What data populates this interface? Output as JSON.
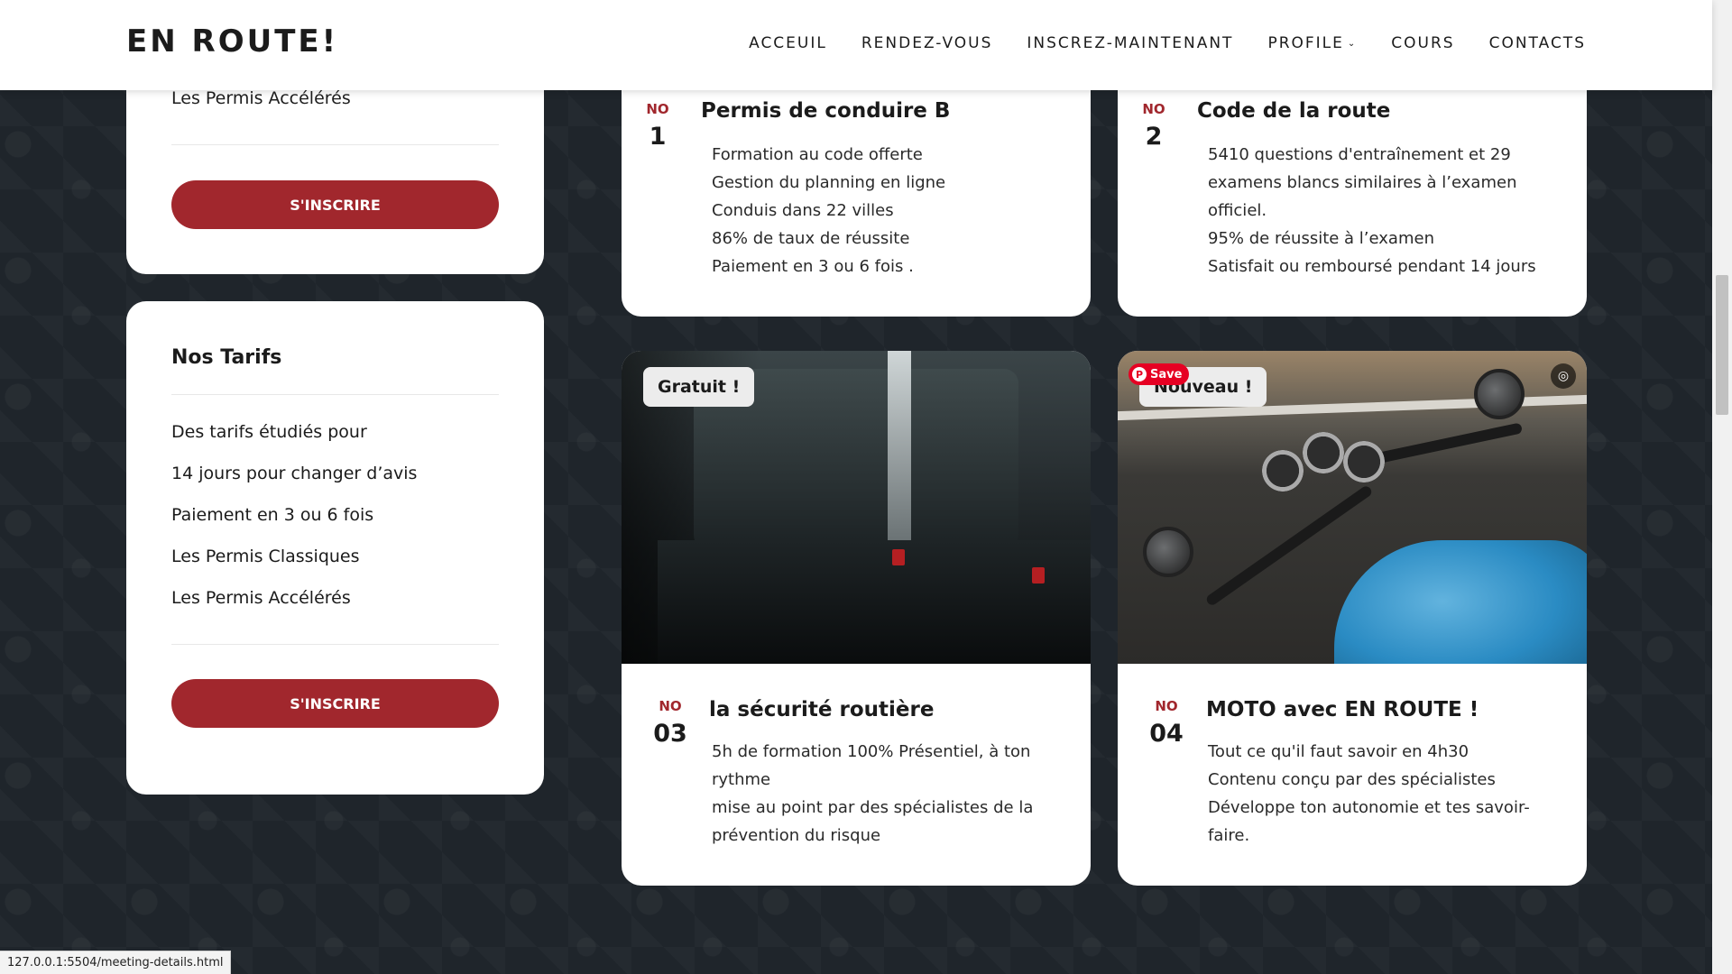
{
  "header": {
    "logo": "EN ROUTE!",
    "nav": [
      "ACCEUIL",
      "RENDEZ-VOUS",
      "INSCREZ-MAINTENANT",
      "PROFILE",
      "COURS",
      "CONTACTS"
    ]
  },
  "sidebar": {
    "top_card": {
      "item": "Les Permis Accélérés",
      "button": "S'INSCRIRE"
    },
    "tarifs_card": {
      "title": "Nos Tarifs",
      "items": [
        "Des tarifs étudiés pour",
        "14 jours pour changer d’avis",
        "Paiement en 3 ou 6 fois",
        "Les Permis Classiques",
        "Les Permis Accélérés"
      ],
      "button": "S'INSCRIRE"
    }
  },
  "courses": [
    {
      "no_label": "NO",
      "no": "1",
      "title": "Permis de conduire B",
      "lines": [
        "Formation au code offerte",
        "Gestion du planning en ligne",
        "Conduis dans 22 villes",
        "86% de taux de réussite",
        "Paiement en 3 ou 6 fois ."
      ]
    },
    {
      "no_label": "NO",
      "no": "2",
      "title": "Code de la route",
      "lines": [
        "5410 questions d'entraînement et 29",
        "examens blancs similaires à l’examen",
        "officiel.",
        "95% de réussite à l’examen",
        "Satisfait ou remboursé pendant 14 jours"
      ]
    },
    {
      "badge": "Gratuit !",
      "no_label": "NO",
      "no": "03",
      "title": "la sécurité routière",
      "lines": [
        "5h de formation 100% Présentiel, à ton",
        "rythme",
        "mise au point par des spécialistes de la",
        "prévention du risque"
      ]
    },
    {
      "badge": "Nouveau !",
      "pin_save": "Save",
      "no_label": "NO",
      "no": "04",
      "title": "MOTO avec EN ROUTE !",
      "lines": [
        "Tout ce qu'il faut savoir en 4h30",
        "Contenu conçu par des spécialistes",
        "Développe ton autonomie et tes savoir-",
        "faire."
      ]
    }
  ],
  "status_bar": "127.0.0.1:5504/meeting-details.html",
  "colors": {
    "accent": "#a1272d",
    "background": "#1f252b",
    "card": "#ffffff"
  },
  "icons": {
    "profile_dropdown": "chevron-down-icon",
    "pinterest": "pinterest-icon",
    "lens": "lens-search-icon"
  }
}
